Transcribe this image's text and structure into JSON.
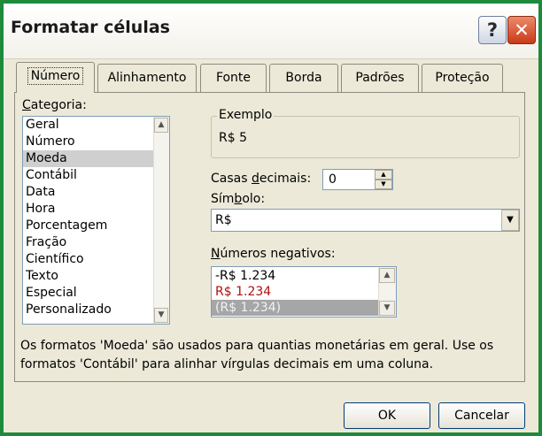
{
  "window": {
    "title": "Formatar células",
    "help_glyph": "?",
    "close_glyph": "✕"
  },
  "tabs": [
    {
      "label": "Número",
      "active": true
    },
    {
      "label": "Alinhamento",
      "active": false
    },
    {
      "label": "Fonte",
      "active": false
    },
    {
      "label": "Borda",
      "active": false
    },
    {
      "label": "Padrões",
      "active": false
    },
    {
      "label": "Proteção",
      "active": false
    }
  ],
  "category": {
    "label_first": "C",
    "label_rest": "ategoria:",
    "items": [
      "Geral",
      "Número",
      "Moeda",
      "Contábil",
      "Data",
      "Hora",
      "Porcentagem",
      "Fração",
      "Científico",
      "Texto",
      "Especial",
      "Personalizado"
    ],
    "selected": "Moeda"
  },
  "sample": {
    "legend": "Exemplo",
    "value": "R$ 5"
  },
  "decimal": {
    "label_pre": "Casas ",
    "label_u": "d",
    "label_post": "ecimais:",
    "value": "0"
  },
  "symbol": {
    "label_pre": "Sím",
    "label_u": "b",
    "label_post": "olo:",
    "value": "R$"
  },
  "negatives": {
    "label_pre": "",
    "label_u": "N",
    "label_post": "úmeros negativos:",
    "items": [
      {
        "text": "-R$ 1.234",
        "color": "#000000"
      },
      {
        "text": "R$ 1.234",
        "color": "#b01010"
      },
      {
        "text": "(R$ 1.234)",
        "color": "#f2f2f2"
      }
    ],
    "selected_index": 2
  },
  "description": "Os formatos 'Moeda' são usados para quantias monetárias em geral. Use os formatos 'Contábil' para alinhar vírgulas decimais em uma coluna.",
  "buttons": {
    "ok": "OK",
    "cancel": "Cancelar"
  },
  "colors": {
    "outer_frame": "#1d8a3c",
    "dialog_bg": "#ece9d8",
    "negative_red": "#b01010"
  }
}
